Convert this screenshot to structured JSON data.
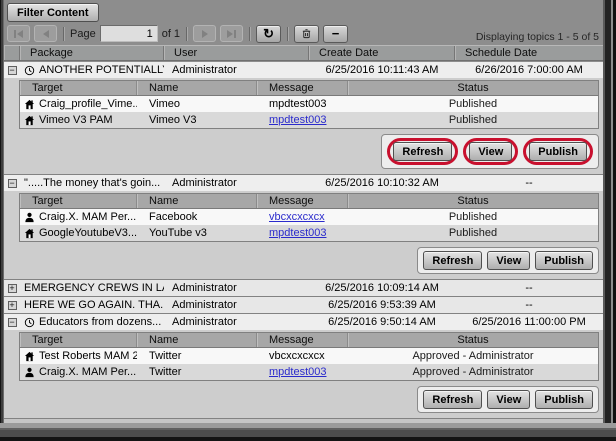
{
  "toolbar": {
    "filter_button": "Filter Content",
    "page_label": "Page",
    "page_value": "1",
    "of_label": "of 1",
    "refresh_icon": "refresh-icon",
    "trash_icon": "trash-icon",
    "minus_icon": "minus-icon",
    "displaying": "Displaying topics 1 - 5 of 5"
  },
  "columns": {
    "package": "Package",
    "user": "User",
    "create_date": "Create Date",
    "schedule_date": "Schedule Date"
  },
  "subcolumns": {
    "target": "Target",
    "name": "Name",
    "message": "Message",
    "status": "Status"
  },
  "buttons": {
    "refresh": "Refresh",
    "view": "View",
    "publish": "Publish"
  },
  "colors": {
    "annotation": "#c8102e",
    "link": "#2b2bcc"
  },
  "groups": [
    {
      "expanded": true,
      "scheduled": true,
      "annotated": true,
      "package": "ANOTHER POTENTIALLY...",
      "user": "Administrator",
      "create_date": "6/25/2016 10:11:43 AM",
      "schedule_date": "6/26/2016 7:00:00 AM",
      "rows": [
        {
          "icon": "house-icon",
          "target": "Craig_profile_Vime...",
          "name": "Vimeo",
          "message": "mpdtest003",
          "message_is_link": false,
          "status": "Published"
        },
        {
          "icon": "house-icon",
          "target": "Vimeo V3 PAM",
          "name": "Vimeo V3",
          "message": "mpdtest003",
          "message_is_link": true,
          "status": "Published"
        }
      ]
    },
    {
      "expanded": true,
      "scheduled": false,
      "annotated": false,
      "package": "\".....The money that's goin...",
      "user": "Administrator",
      "create_date": "6/25/2016 10:10:32 AM",
      "schedule_date": "--",
      "rows": [
        {
          "icon": "person-icon",
          "target": "Craig.X. MAM Per...",
          "name": "Facebook",
          "message": "vbcxcxcxcx",
          "message_is_link": true,
          "status": "Published"
        },
        {
          "icon": "house-icon",
          "target": "GoogleYoutubeV3...",
          "name": "YouTube v3",
          "message": "mpdtest003",
          "message_is_link": true,
          "status": "Published"
        }
      ]
    },
    {
      "expanded": false,
      "scheduled": false,
      "annotated": false,
      "package": "EMERGENCY CREWS IN LA...",
      "user": "Administrator",
      "create_date": "6/25/2016 10:09:14 AM",
      "schedule_date": "--"
    },
    {
      "expanded": false,
      "scheduled": false,
      "annotated": false,
      "package": "HERE WE GO AGAIN. THA...",
      "user": "Administrator",
      "create_date": "6/25/2016 9:53:39 AM",
      "schedule_date": "--"
    },
    {
      "expanded": true,
      "scheduled": true,
      "annotated": false,
      "package": "Educators from dozens...",
      "user": "Administrator",
      "create_date": "6/25/2016 9:50:14 AM",
      "schedule_date": "6/25/2016 11:00:00 PM",
      "rows": [
        {
          "icon": "house-icon",
          "target": "Test Roberts MAM 2",
          "name": "Twitter",
          "message": "vbcxcxcxcx",
          "message_is_link": false,
          "status": "Approved - Administrator"
        },
        {
          "icon": "person-icon",
          "target": "Craig.X. MAM Per...",
          "name": "Twitter",
          "message": "mpdtest003",
          "message_is_link": true,
          "status": "Approved - Administrator"
        }
      ]
    }
  ]
}
